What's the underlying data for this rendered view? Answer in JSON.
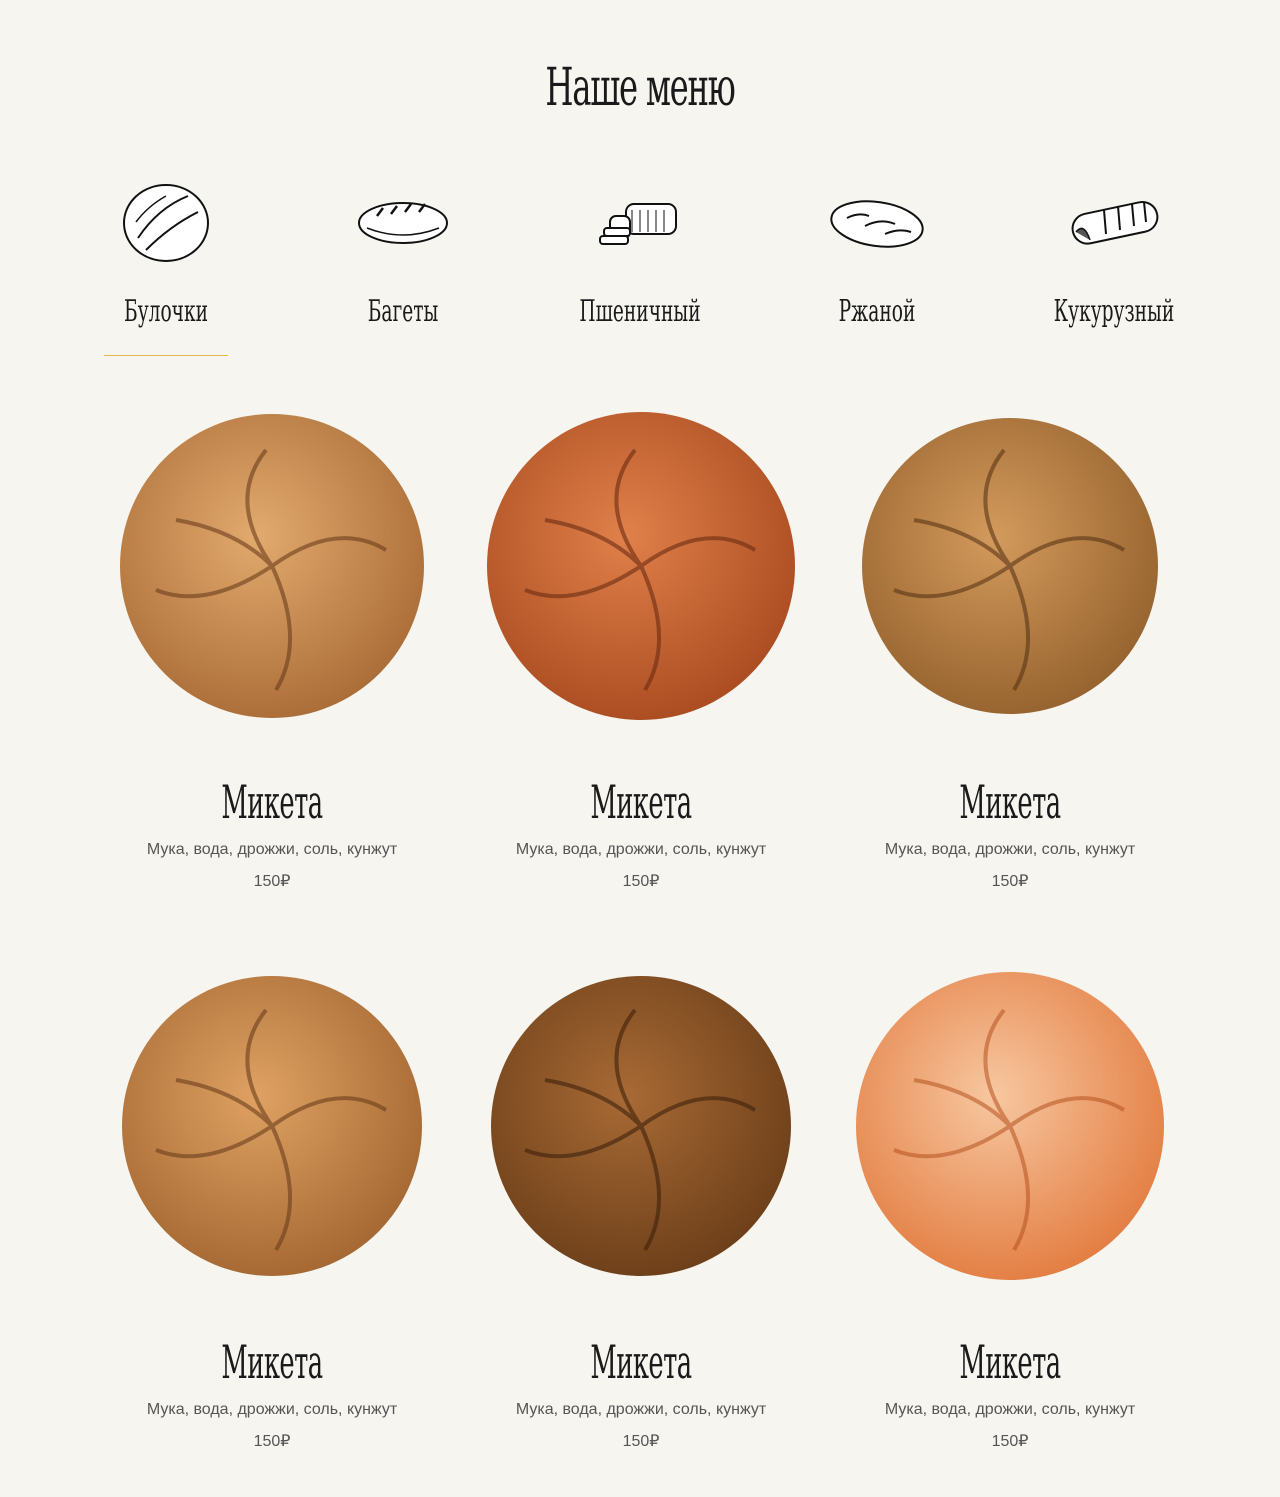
{
  "page_title": "Наше меню",
  "colors": {
    "background": "#f6f5f0",
    "accent": "#e0b94a",
    "text": "#1a1a1a",
    "muted": "#555555"
  },
  "tabs": [
    {
      "label": "Булочки",
      "icon": "round-bread-icon",
      "active": true
    },
    {
      "label": "Багеты",
      "icon": "baguette-icon",
      "active": false
    },
    {
      "label": "Пшеничный",
      "icon": "sliced-loaf-icon",
      "active": false
    },
    {
      "label": "Ржаной",
      "icon": "rye-loaf-icon",
      "active": false
    },
    {
      "label": "Кукурузный",
      "icon": "corn-bread-icon",
      "active": false
    }
  ],
  "products": [
    {
      "name": "Микета",
      "ingredients": "Мука, вода, дрожжи, соль, кунжут",
      "price": "150₽",
      "color": "#c98a4e"
    },
    {
      "name": "Микета",
      "ingredients": "Мука, вода, дрожжи, соль, кунжут",
      "price": "150₽",
      "color": "#c8602e"
    },
    {
      "name": "Микета",
      "ingredients": "Мука, вода, дрожжи, соль, кунжут",
      "price": "150₽",
      "color": "#b57a3f"
    },
    {
      "name": "Микета",
      "ingredients": "Мука, вода, дрожжи, соль, кунжут",
      "price": "150₽",
      "color": "#c68243"
    },
    {
      "name": "Микета",
      "ingredients": "Мука, вода, дрожжи, соль, кунжут",
      "price": "150₽",
      "color": "#8c5227"
    },
    {
      "name": "Микета",
      "ingredients": "Мука, вода, дрожжи, соль, кунжут",
      "price": "150₽",
      "color": "#ec9a62"
    }
  ]
}
